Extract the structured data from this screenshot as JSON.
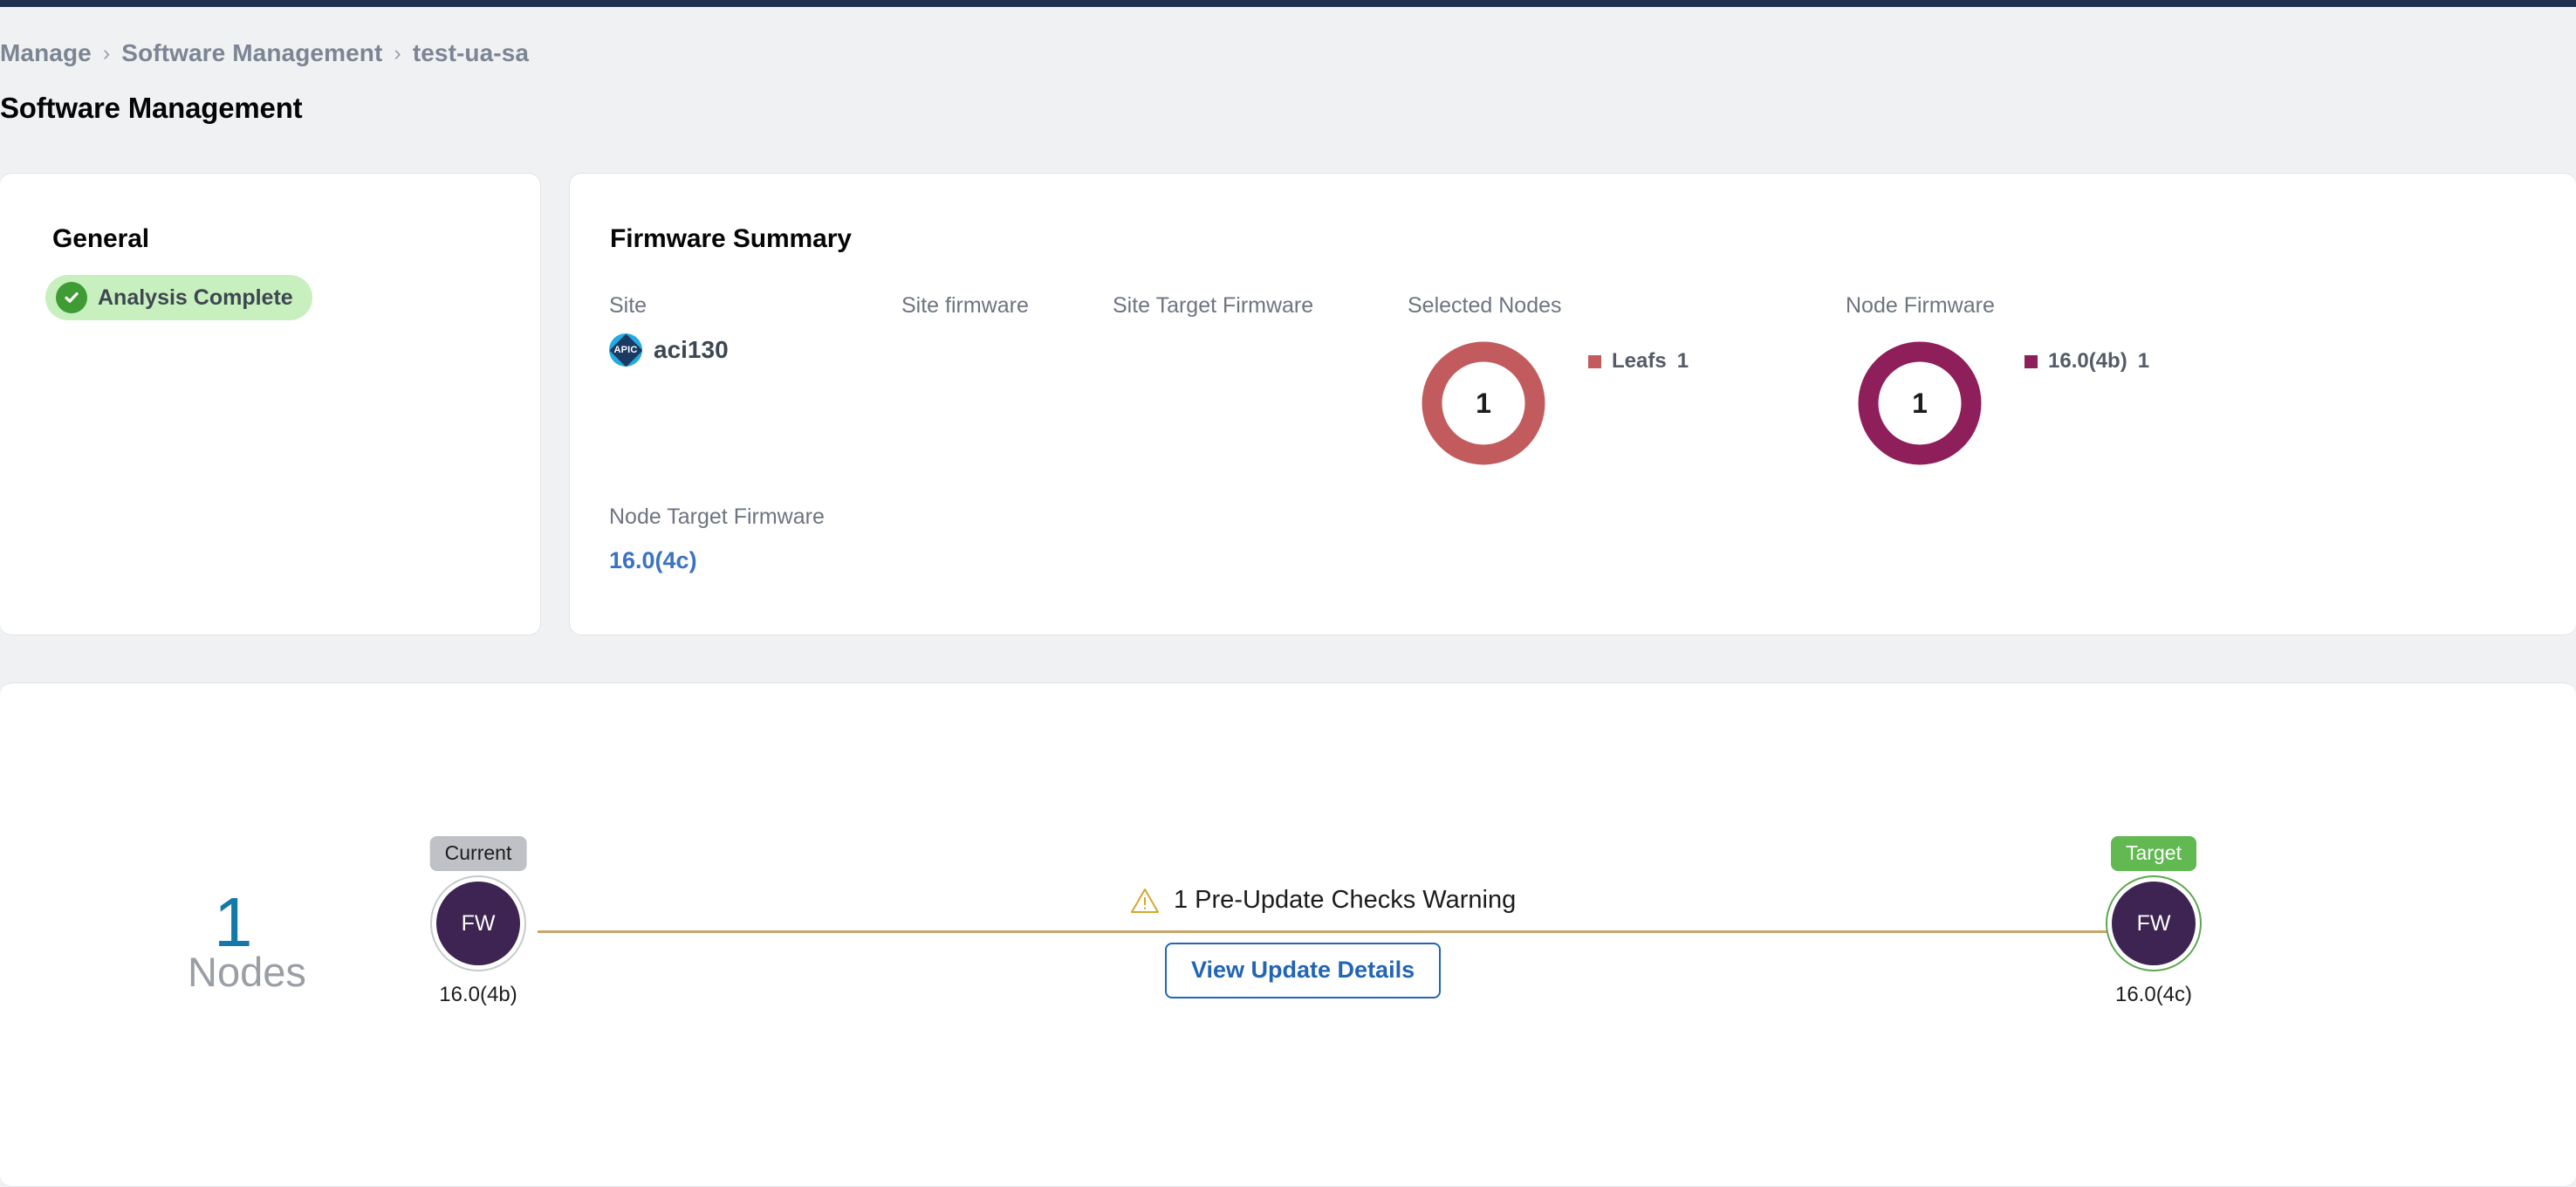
{
  "breadcrumb": {
    "items": [
      "Manage",
      "Software Management",
      "test-ua-sa"
    ],
    "separator": "›"
  },
  "page": {
    "title": "Software Management"
  },
  "general": {
    "heading": "General",
    "status": {
      "label": "Analysis Complete",
      "icon": "check-circle-icon",
      "bg_color": "#c8efbe",
      "icon_color": "#3f9c35",
      "text_color": "#3d4751"
    }
  },
  "firmware_summary": {
    "heading": "Firmware Summary",
    "labels": {
      "site": "Site",
      "site_firmware": "Site firmware",
      "site_target_firmware": "Site Target Firmware",
      "selected_nodes": "Selected Nodes",
      "node_firmware": "Node Firmware",
      "node_target_firmware": "Node Target Firmware"
    },
    "site": {
      "name": "aci130",
      "icon": "apic-icon",
      "icon_label": "APIC"
    },
    "site_firmware_value": "",
    "site_target_firmware_value": "",
    "node_target_firmware_value": "16.0(4c)",
    "node_target_firmware_color": "#3a72c4"
  },
  "chart_data": [
    {
      "type": "pie",
      "title": "Selected Nodes",
      "center_label": "1",
      "categories": [
        "Leafs"
      ],
      "values": [
        1
      ],
      "colors": [
        "#c25b5e"
      ],
      "legend": [
        {
          "name": "Leafs",
          "value": "1",
          "color": "#c25b5e"
        }
      ],
      "legend_position": "right"
    },
    {
      "type": "pie",
      "title": "Node Firmware",
      "center_label": "1",
      "categories": [
        "16.0(4b)"
      ],
      "values": [
        1
      ],
      "colors": [
        "#8e1f5a"
      ],
      "legend": [
        {
          "name": "16.0(4b)",
          "value": "1",
          "color": "#8e1f5a"
        }
      ],
      "legend_position": "right"
    }
  ],
  "timeline": {
    "nodes_count": "1",
    "nodes_label": "Nodes",
    "nodes_count_color": "#1478a8",
    "line_color": "#c8a468",
    "current": {
      "badge": "Current",
      "badge_bg": "#bfc1c6",
      "circle_label": "FW",
      "version": "16.0(4b)",
      "ring_color": "#c7c9cd"
    },
    "target": {
      "badge": "Target",
      "badge_bg": "#62b952",
      "circle_label": "FW",
      "version": "16.0(4c)",
      "ring_color": "#5aa84f"
    },
    "warning": {
      "icon": "warning-triangle-icon",
      "text": "1 Pre-Update Checks Warning",
      "icon_color": "#d4a72c"
    },
    "view_details_button": "View Update Details"
  }
}
